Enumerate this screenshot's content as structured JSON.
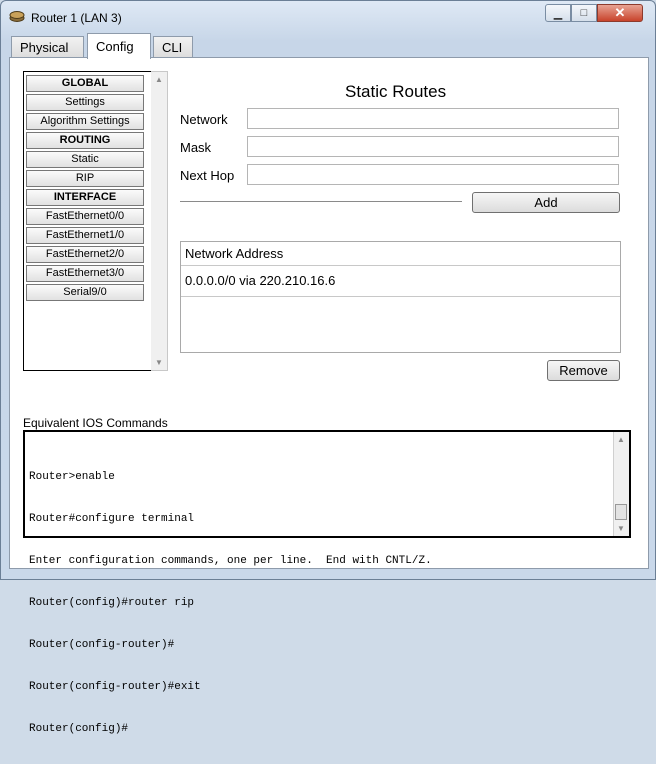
{
  "window": {
    "title": "Router 1 (LAN 3)"
  },
  "tabs": [
    {
      "label": "Physical"
    },
    {
      "label": "Config"
    },
    {
      "label": "CLI"
    }
  ],
  "nav": {
    "items": [
      {
        "label": "GLOBAL",
        "type": "header"
      },
      {
        "label": "Settings"
      },
      {
        "label": "Algorithm Settings"
      },
      {
        "label": "ROUTING",
        "type": "header"
      },
      {
        "label": "Static"
      },
      {
        "label": "RIP"
      },
      {
        "label": "INTERFACE",
        "type": "header"
      },
      {
        "label": "FastEthernet0/0"
      },
      {
        "label": "FastEthernet1/0"
      },
      {
        "label": "FastEthernet2/0"
      },
      {
        "label": "FastEthernet3/0"
      },
      {
        "label": "Serial9/0"
      }
    ]
  },
  "static_routes": {
    "title": "Static Routes",
    "network_label": "Network",
    "mask_label": "Mask",
    "next_hop_label": "Next Hop",
    "network_value": "",
    "mask_value": "",
    "next_hop_value": "",
    "add_label": "Add",
    "table_header": "Network Address",
    "rows": [
      "0.0.0.0/0 via 220.210.16.6"
    ],
    "remove_label": "Remove"
  },
  "ios": {
    "label": "Equivalent IOS Commands",
    "lines": [
      "Router>enable",
      "Router#configure terminal",
      "Enter configuration commands, one per line.  End with CNTL/Z.",
      "Router(config)#router rip",
      "Router(config-router)#",
      "Router(config-router)#exit",
      "Router(config)#"
    ]
  },
  "colors": {
    "accent_close": "#c8432b",
    "window_bg": "#cfdbe8"
  }
}
